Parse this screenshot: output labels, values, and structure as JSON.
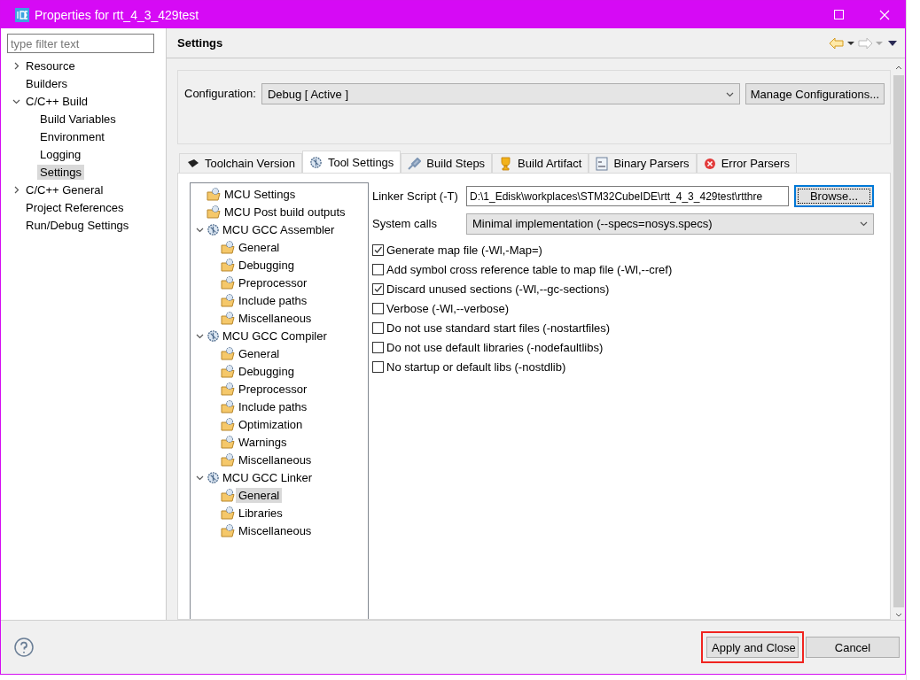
{
  "window": {
    "title": "Properties for rtt_4_3_429test"
  },
  "filter": {
    "placeholder": "type filter text"
  },
  "nav": [
    {
      "label": "Resource",
      "kind": "branch",
      "expanded": false,
      "selected": false
    },
    {
      "label": "Builders",
      "kind": "leaf",
      "selected": false
    },
    {
      "label": "C/C++ Build",
      "kind": "branch",
      "expanded": true,
      "selected": false,
      "children": [
        {
          "label": "Build Variables",
          "kind": "leaf",
          "selected": false
        },
        {
          "label": "Environment",
          "kind": "leaf",
          "selected": false
        },
        {
          "label": "Logging",
          "kind": "leaf",
          "selected": false
        },
        {
          "label": "Settings",
          "kind": "leaf",
          "selected": true
        }
      ]
    },
    {
      "label": "C/C++ General",
      "kind": "branch",
      "expanded": false,
      "selected": false
    },
    {
      "label": "Project References",
      "kind": "leaf",
      "selected": false
    },
    {
      "label": "Run/Debug Settings",
      "kind": "leaf",
      "selected": false
    }
  ],
  "page_title": "Settings",
  "configuration": {
    "label": "Configuration:",
    "value": "Debug  [ Active ]",
    "manage_button": "Manage Configurations..."
  },
  "tabs": [
    {
      "label": "Toolchain  Version",
      "kind": "chip",
      "selected": false
    },
    {
      "label": "Tool Settings",
      "kind": "gear",
      "selected": true
    },
    {
      "label": "Build Steps",
      "kind": "brush",
      "selected": false
    },
    {
      "label": "Build Artifact",
      "kind": "trophy",
      "selected": false
    },
    {
      "label": "Binary Parsers",
      "kind": "binary",
      "selected": false
    },
    {
      "label": "Error Parsers",
      "kind": "error",
      "selected": false
    }
  ],
  "tool_tree": [
    {
      "label": "MCU Settings",
      "kind": "page",
      "selected": false
    },
    {
      "label": "MCU Post build outputs",
      "kind": "page",
      "selected": false
    },
    {
      "label": "MCU GCC Assembler",
      "kind": "tool",
      "expanded": true,
      "selected": false,
      "children": [
        {
          "label": "General",
          "kind": "page",
          "selected": false
        },
        {
          "label": "Debugging",
          "kind": "page",
          "selected": false
        },
        {
          "label": "Preprocessor",
          "kind": "page",
          "selected": false
        },
        {
          "label": "Include paths",
          "kind": "page",
          "selected": false
        },
        {
          "label": "Miscellaneous",
          "kind": "page",
          "selected": false
        }
      ]
    },
    {
      "label": "MCU GCC Compiler",
      "kind": "tool",
      "expanded": true,
      "selected": false,
      "children": [
        {
          "label": "General",
          "kind": "page",
          "selected": false
        },
        {
          "label": "Debugging",
          "kind": "page",
          "selected": false
        },
        {
          "label": "Preprocessor",
          "kind": "page",
          "selected": false
        },
        {
          "label": "Include paths",
          "kind": "page",
          "selected": false
        },
        {
          "label": "Optimization",
          "kind": "page",
          "selected": false
        },
        {
          "label": "Warnings",
          "kind": "page",
          "selected": false
        },
        {
          "label": "Miscellaneous",
          "kind": "page",
          "selected": false
        }
      ]
    },
    {
      "label": "MCU GCC Linker",
      "kind": "tool",
      "expanded": true,
      "selected": false,
      "children": [
        {
          "label": "General",
          "kind": "page",
          "selected": true
        },
        {
          "label": "Libraries",
          "kind": "page",
          "selected": false
        },
        {
          "label": "Miscellaneous",
          "kind": "page",
          "selected": false
        }
      ]
    }
  ],
  "linker_script": {
    "label": "Linker Script (-T)",
    "value": "D:\\1_Edisk\\workplaces\\STM32CubeIDE\\rtt_4_3_429test\\rtthre",
    "button": "Browse..."
  },
  "system_calls": {
    "label": "System calls",
    "value": "Minimal implementation (--specs=nosys.specs)"
  },
  "options": [
    {
      "label": "Generate map file (-Wl,-Map=)",
      "checked": true
    },
    {
      "label": "Add symbol cross reference table to map file (-Wl,--cref)",
      "checked": false
    },
    {
      "label": "Discard unused sections (-Wl,--gc-sections)",
      "checked": true
    },
    {
      "label": "Verbose (-Wl,--verbose)",
      "checked": false
    },
    {
      "label": "Do not use standard start files (-nostartfiles)",
      "checked": false
    },
    {
      "label": "Do not use default libraries (-nodefaultlibs)",
      "checked": false
    },
    {
      "label": "No startup or default libs (-nostdlib)",
      "checked": false
    }
  ],
  "footer": {
    "buttons": [
      {
        "label": "Apply and Close",
        "highlighted": true
      },
      {
        "label": "Cancel",
        "highlighted": false
      }
    ]
  }
}
